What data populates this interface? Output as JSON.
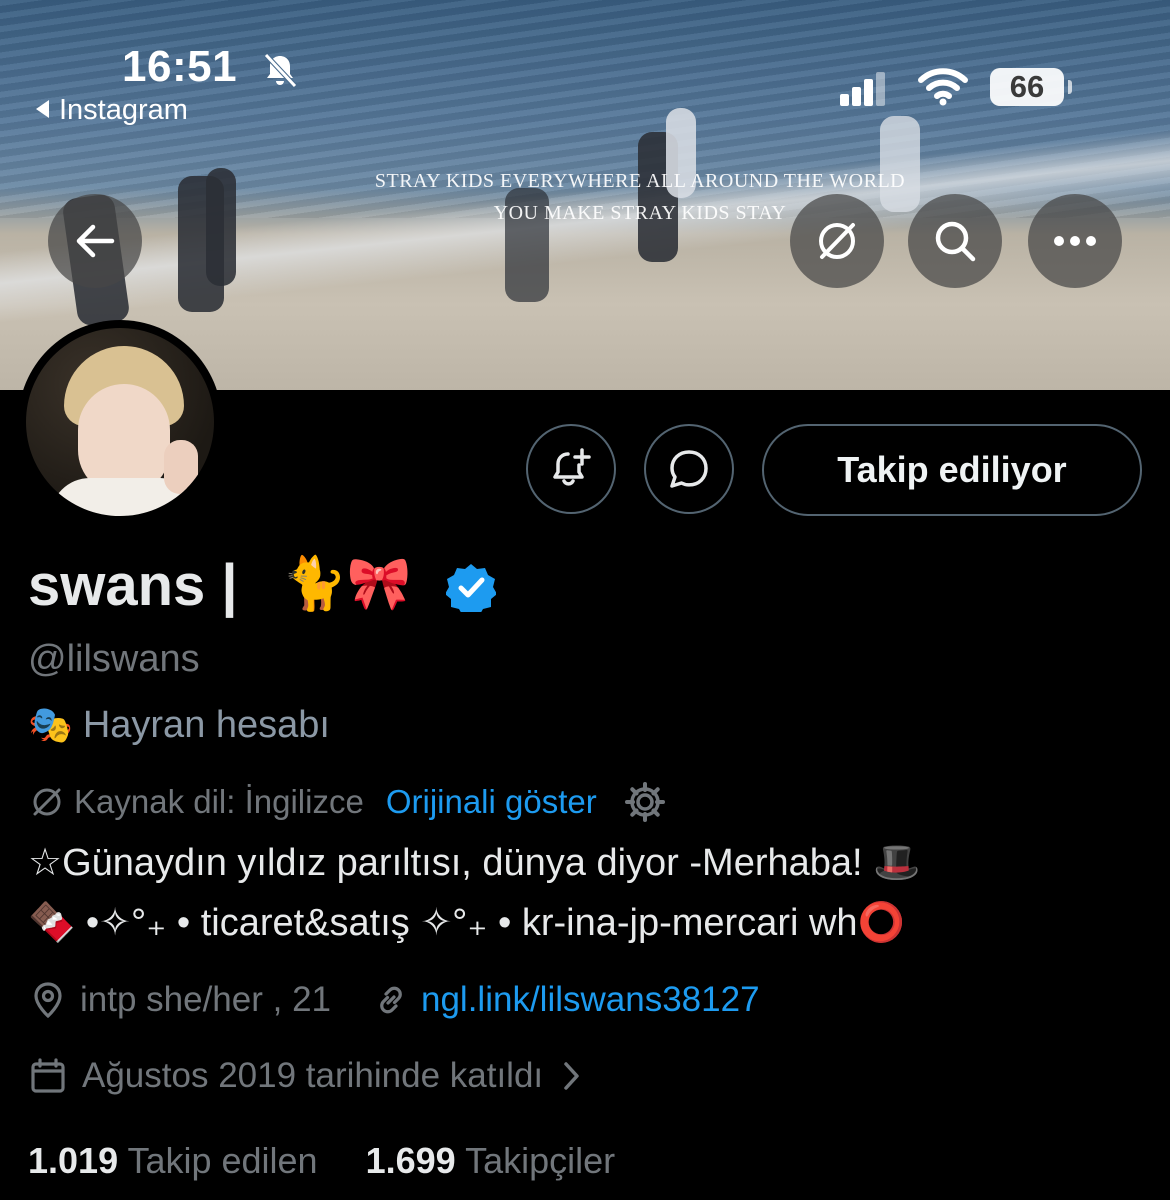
{
  "status_bar": {
    "time": "16:51",
    "back_app": "Instagram",
    "battery": "66"
  },
  "banner": {
    "line1": "STRAY KIDS EVERYWHERE ALL AROUND THE WORLD",
    "line2": "YOU MAKE STRAY KIDS STAY"
  },
  "header_buttons": [
    "back-arrow-icon",
    "translate-icon",
    "search-icon",
    "more-icon"
  ],
  "profile": {
    "display_name": "swans | ",
    "name_emojis": "🐈🎀",
    "handle": "@lilswans",
    "category": "Hayran hesabı",
    "category_icon": "🎭",
    "source_language": "Kaynak dil: İngilizce",
    "show_original": "Orijinali göster",
    "bio_line1": "☆Günaydın yıldız parıltısı, dünya diyor -Merhaba! 🎩",
    "bio_line2": "🍫 •✧°₊ •  ticaret&satış ✧°₊ • kr-ina-jp-mercari wh⭕",
    "location": "intp she/her , 21",
    "website": "ngl.link/lilswans38127",
    "joined": "Ağustos 2019 tarihinde katıldı",
    "following_count": "1.019",
    "following_label": "Takip edilen",
    "followers_count": "1.699",
    "followers_label": "Takipçiler"
  },
  "actions": {
    "follow_button": "Takip ediliyor",
    "notify_icon": "bell-plus-icon",
    "message_icon": "message-icon"
  },
  "colors": {
    "background": "#000000",
    "link": "#1d9bf0",
    "secondary_text": "#71767b",
    "verified": "#1d9bf0"
  }
}
